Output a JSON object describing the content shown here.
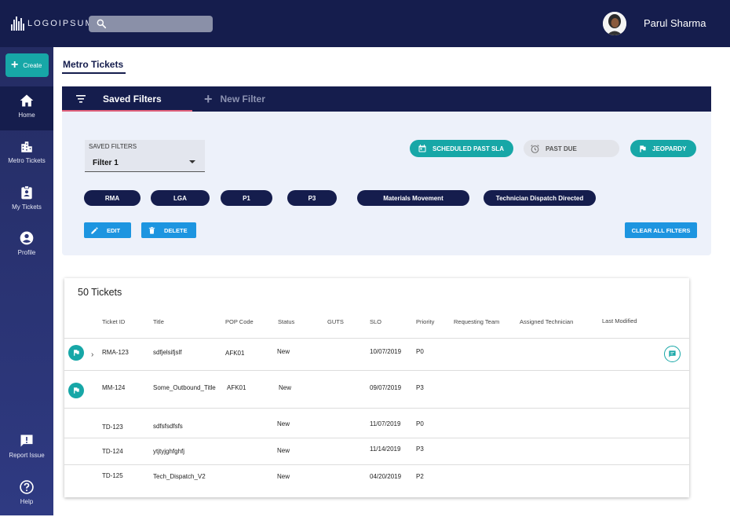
{
  "brand": {
    "logo_text": "LOGOIPSUM"
  },
  "header": {
    "search_placeholder": "",
    "user_name": "Parul Sharma"
  },
  "colors": {
    "navy": "#151d4d",
    "teal": "#17a7a7",
    "blue": "#1d95e0",
    "pink": "#e0607a"
  },
  "sidebar": {
    "create_label": "Create",
    "items": [
      {
        "label": "Home",
        "icon": "home-icon",
        "active": true
      },
      {
        "label": "Metro Tickets",
        "icon": "building-icon",
        "active": false
      },
      {
        "label": "My Tickets",
        "icon": "badge-icon",
        "active": false
      },
      {
        "label": "Profile",
        "icon": "account-icon",
        "active": false
      },
      {
        "label": "Report Issue",
        "icon": "report-icon",
        "active": false
      },
      {
        "label": "Help",
        "icon": "help-icon",
        "active": false
      }
    ]
  },
  "page": {
    "title": "Metro Tickets"
  },
  "filters": {
    "tab_saved": "Saved Filters",
    "tab_new": "New Filter",
    "select_label": "SAVED FILTERS",
    "select_value": "Filter 1",
    "quick_filters": [
      "SCHEDULED PAST SLA",
      "PAST DUE",
      "JEOPARDY"
    ],
    "chips": [
      "RMA",
      "LGA",
      "P1",
      "P3",
      "Materials Movement",
      "Technician Dispatch Directed"
    ],
    "edit_label": "EDIT",
    "delete_label": "DELETE",
    "clear_label": "CLEAR ALL FILTERS"
  },
  "tickets": {
    "title": "50 Tickets",
    "columns": [
      "Ticket ID",
      "Title",
      "POP Code",
      "Status",
      "GUTS",
      "SLO",
      "Priority",
      "Requesting Team",
      "Assigned Technician",
      "Last Modified"
    ],
    "rows": [
      {
        "id": "RMA-123",
        "title": "sdfjelsifjslf",
        "pop": "AFK01",
        "status": "New",
        "slo": "10/07/2019",
        "priority": "P0"
      },
      {
        "id": "MM-124",
        "title": "Some_Outbound_Title",
        "pop": "AFK01",
        "status": "New",
        "slo": "09/07/2019",
        "priority": "P3"
      },
      {
        "id": "TD-123",
        "title": "sdfsfsdfsfs",
        "pop": "",
        "status": "New",
        "slo": "11/07/2019",
        "priority": "P0"
      },
      {
        "id": "TD-124",
        "title": "ytjtyjghfghfj",
        "pop": "",
        "status": "New",
        "slo": "11/14/2019",
        "priority": "P3"
      },
      {
        "id": "TD-125",
        "title": "Tech_Dispatch_V2",
        "pop": "",
        "status": "New",
        "slo": "04/20/2019",
        "priority": "P2"
      }
    ]
  }
}
